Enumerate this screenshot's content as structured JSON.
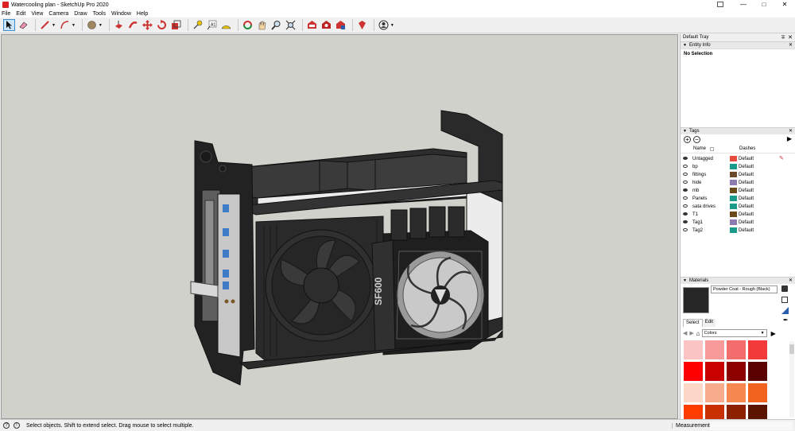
{
  "window": {
    "title": "Watercooling plan - SketchUp Pro 2020",
    "controls": [
      "—",
      "□",
      "✕"
    ]
  },
  "menu": [
    "File",
    "Edit",
    "View",
    "Camera",
    "Draw",
    "Tools",
    "Window",
    "Help"
  ],
  "toolbar": {
    "tools": [
      "select",
      "eraser",
      "pencil",
      "arc",
      "paint",
      "push-pull",
      "follow-me",
      "move",
      "rotate",
      "scale",
      "tape",
      "text",
      "protractor",
      "orbit",
      "pan",
      "zoom",
      "zoom-extents",
      "warehouse",
      "extensions",
      "sketchup-send",
      "ruby",
      "account"
    ]
  },
  "tray": {
    "title": "Default Tray",
    "entity_info": {
      "header": "Entity Info",
      "selection": "No Selection"
    },
    "tags": {
      "header": "Tags",
      "col_name": "Name",
      "col_dashes": "Dashes",
      "rows": [
        {
          "name": "Untagged",
          "dashes": "Default",
          "color": "#e84c3d",
          "visible": true
        },
        {
          "name": "bp",
          "dashes": "Default",
          "color": "#1a9a8a",
          "visible": false
        },
        {
          "name": "fittings",
          "dashes": "Default",
          "color": "#6b4a2c",
          "visible": false
        },
        {
          "name": "hide",
          "dashes": "Default",
          "color": "#8d7ab0",
          "visible": false
        },
        {
          "name": "mb",
          "dashes": "Default",
          "color": "#6b4a1a",
          "visible": true
        },
        {
          "name": "Panels",
          "dashes": "Default",
          "color": "#1a9a8a",
          "visible": false
        },
        {
          "name": "sata drives",
          "dashes": "Default",
          "color": "#1a9a8a",
          "visible": false
        },
        {
          "name": "T1",
          "dashes": "Default",
          "color": "#6b4a1a",
          "visible": true
        },
        {
          "name": "Tag1",
          "dashes": "Default",
          "color": "#8d7ab0",
          "visible": true
        },
        {
          "name": "Tag2",
          "dashes": "Default",
          "color": "#1a9a8a",
          "visible": false
        }
      ]
    },
    "materials": {
      "header": "Materials",
      "current": "Powder Coat - Rough (Black)",
      "tab_select": "Select",
      "tab_edit": "Edit",
      "library": "Colors",
      "swatches": [
        "#fbc4c4",
        "#f99a9a",
        "#f46d6d",
        "#f23a3a",
        "#ff0000",
        "#c80000",
        "#8c0000",
        "#5a0000",
        "#fdd8c8",
        "#f8ac8c",
        "#f7884f",
        "#f26320",
        "#ff3c00",
        "#c83000",
        "#8c2000",
        "#5a1400"
      ]
    }
  },
  "status": {
    "hint": "Select objects. Shift to extend select. Drag mouse to select multiple.",
    "measurements_label": "Measurements"
  }
}
